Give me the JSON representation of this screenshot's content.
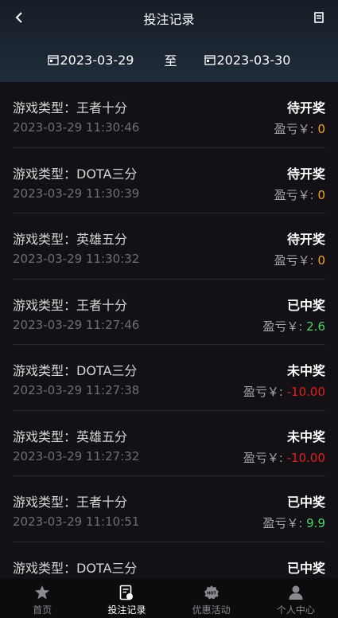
{
  "header": {
    "title": "投注记录",
    "date_from": "2023-03-29",
    "date_sep": "至",
    "date_to": "2023-03-30"
  },
  "colors": {
    "pending": "#f5a623",
    "win": "#4cd964",
    "loss": "#e0221b"
  },
  "records": [
    {
      "game": "游戏类型：王者十分",
      "time": "2023-03-29 11:30:46",
      "status": "待开奖",
      "pnl_label": "盈亏￥: ",
      "pnl_value": "0",
      "kind": "pending"
    },
    {
      "game": "游戏类型：DOTA三分",
      "time": "2023-03-29 11:30:39",
      "status": "待开奖",
      "pnl_label": "盈亏￥: ",
      "pnl_value": "0",
      "kind": "pending"
    },
    {
      "game": "游戏类型：英雄五分",
      "time": "2023-03-29 11:30:32",
      "status": "待开奖",
      "pnl_label": "盈亏￥: ",
      "pnl_value": "0",
      "kind": "pending"
    },
    {
      "game": "游戏类型：王者十分",
      "time": "2023-03-29 11:27:46",
      "status": "已中奖",
      "pnl_label": "盈亏￥: ",
      "pnl_value": "2.6",
      "kind": "win"
    },
    {
      "game": "游戏类型：DOTA三分",
      "time": "2023-03-29 11:27:38",
      "status": "未中奖",
      "pnl_label": "盈亏￥: ",
      "pnl_value": "-10.00",
      "kind": "loss"
    },
    {
      "game": "游戏类型：英雄五分",
      "time": "2023-03-29 11:27:32",
      "status": "未中奖",
      "pnl_label": "盈亏￥: ",
      "pnl_value": "-10.00",
      "kind": "loss"
    },
    {
      "game": "游戏类型：王者十分",
      "time": "2023-03-29 11:10:51",
      "status": "已中奖",
      "pnl_label": "盈亏￥: ",
      "pnl_value": "9.9",
      "kind": "win"
    },
    {
      "game": "游戏类型：DOTA三分",
      "time": "",
      "status": "已中奖",
      "pnl_label": "",
      "pnl_value": "",
      "kind": "win"
    }
  ],
  "tabbar": {
    "tabs": [
      {
        "label": "首页",
        "icon": "star-icon"
      },
      {
        "label": "投注记录",
        "icon": "bet-record-icon"
      },
      {
        "label": "优惠活动",
        "icon": "hot-badge-icon"
      },
      {
        "label": "个人中心",
        "icon": "user-icon"
      }
    ],
    "active_index": 1
  }
}
